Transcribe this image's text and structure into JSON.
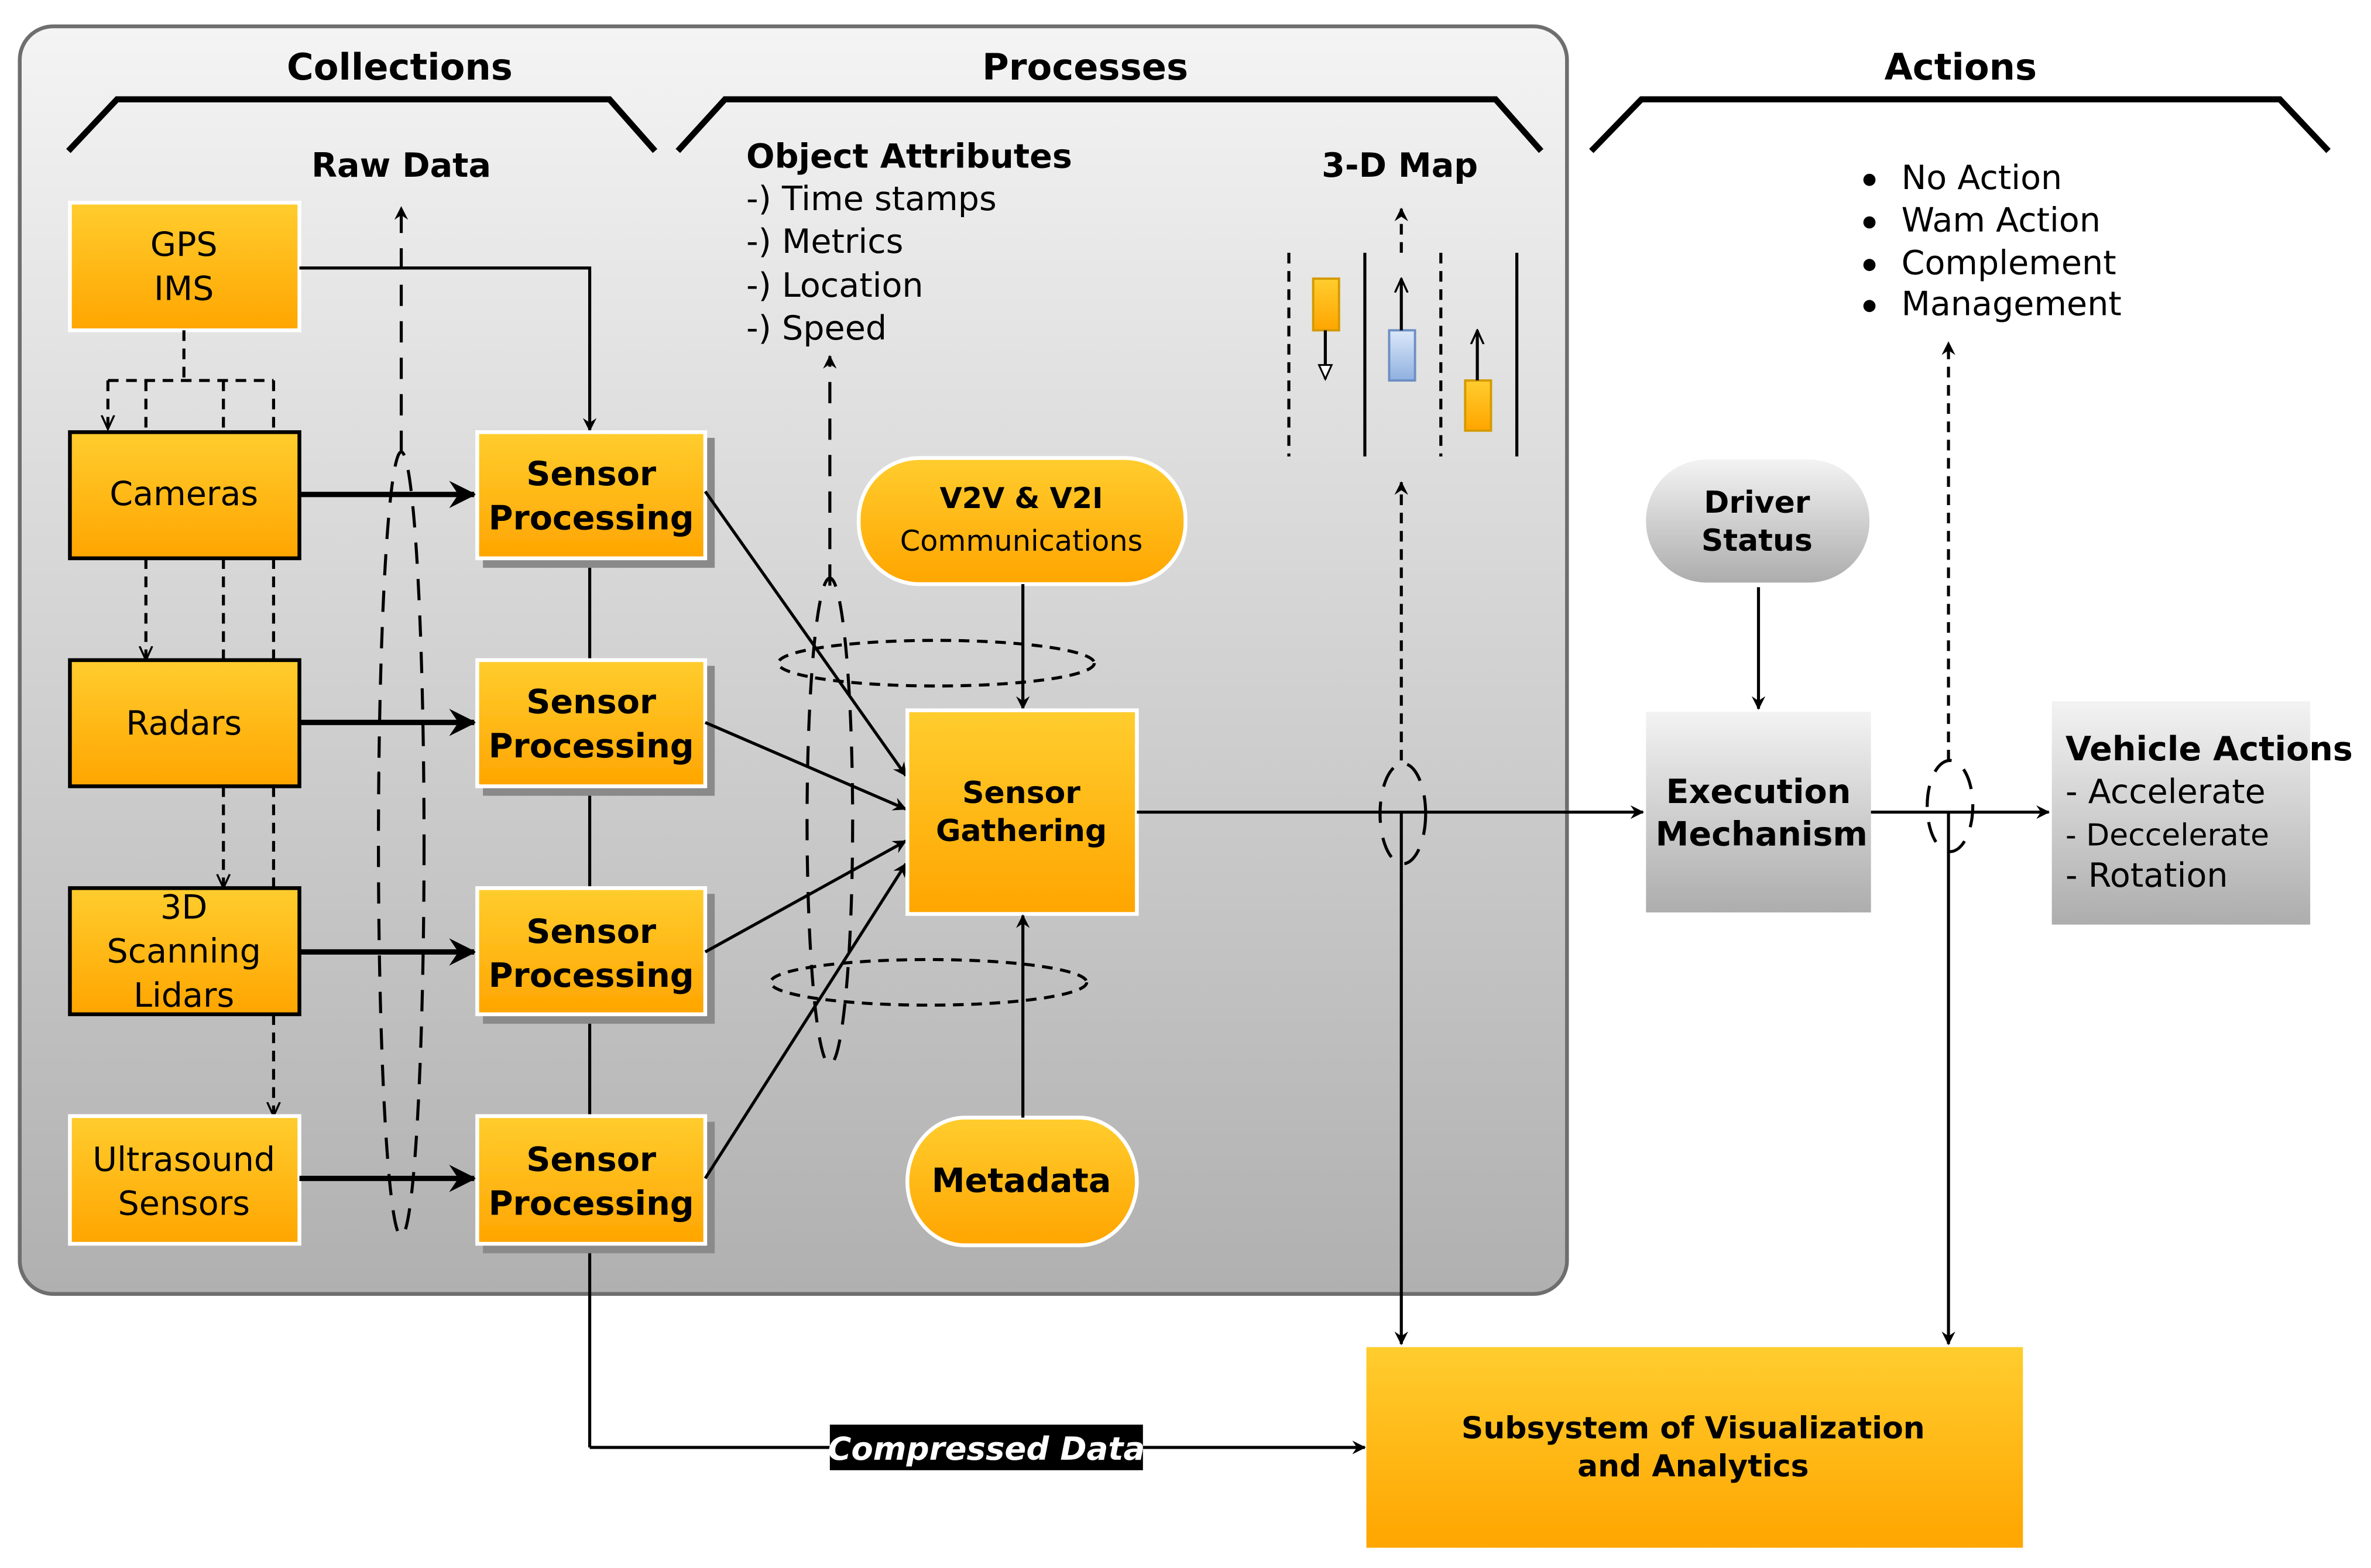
{
  "sections": {
    "collections": "Collections",
    "processes": "Processes",
    "actions": "Actions"
  },
  "raw_data_label": "Raw Data",
  "map_label": "3-D Map",
  "object_attributes": {
    "title": "Object Attributes",
    "items": [
      "-) Time stamps",
      "-) Metrics",
      "-) Location",
      "-) Speed"
    ]
  },
  "sources": [
    {
      "lines": [
        "GPS",
        "IMS"
      ]
    },
    {
      "lines": [
        "Cameras"
      ]
    },
    {
      "lines": [
        "Radars"
      ]
    },
    {
      "lines": [
        "3D",
        "Scanning",
        "Lidars"
      ]
    },
    {
      "lines": [
        "Ultrasound",
        "Sensors"
      ]
    }
  ],
  "sensor_processing": [
    "Sensor",
    "Processing"
  ],
  "v2v": {
    "line1": "V2V  & V2I",
    "line2": "Communications"
  },
  "sensor_gathering": [
    "Sensor",
    "Gathering"
  ],
  "metadata": "Metadata",
  "driver_status": [
    "Driver",
    "Status"
  ],
  "execution_mechanism": [
    "Execution",
    "Mechanism"
  ],
  "vehicle_actions": {
    "title": "Vehicle Actions",
    "items": [
      "- Accelerate",
      "- Deccelerate",
      "- Rotation"
    ]
  },
  "action_list": [
    "No Action",
    "Wam Action",
    "Complement",
    "Management"
  ],
  "compressed_data": "Compressed Data",
  "subsystem": [
    "Subsystem of Visualization",
    "and Analytics"
  ],
  "colors": {
    "orange_top": "#FFCD2E",
    "orange_bottom": "#FFA500",
    "gray_top": "#F2F2F2",
    "gray_bottom": "#B0B0B0",
    "panel_border": "#6E6E6E",
    "blue_car_top": "#DCE8FA",
    "blue_car_bottom": "#7DA3D8"
  }
}
